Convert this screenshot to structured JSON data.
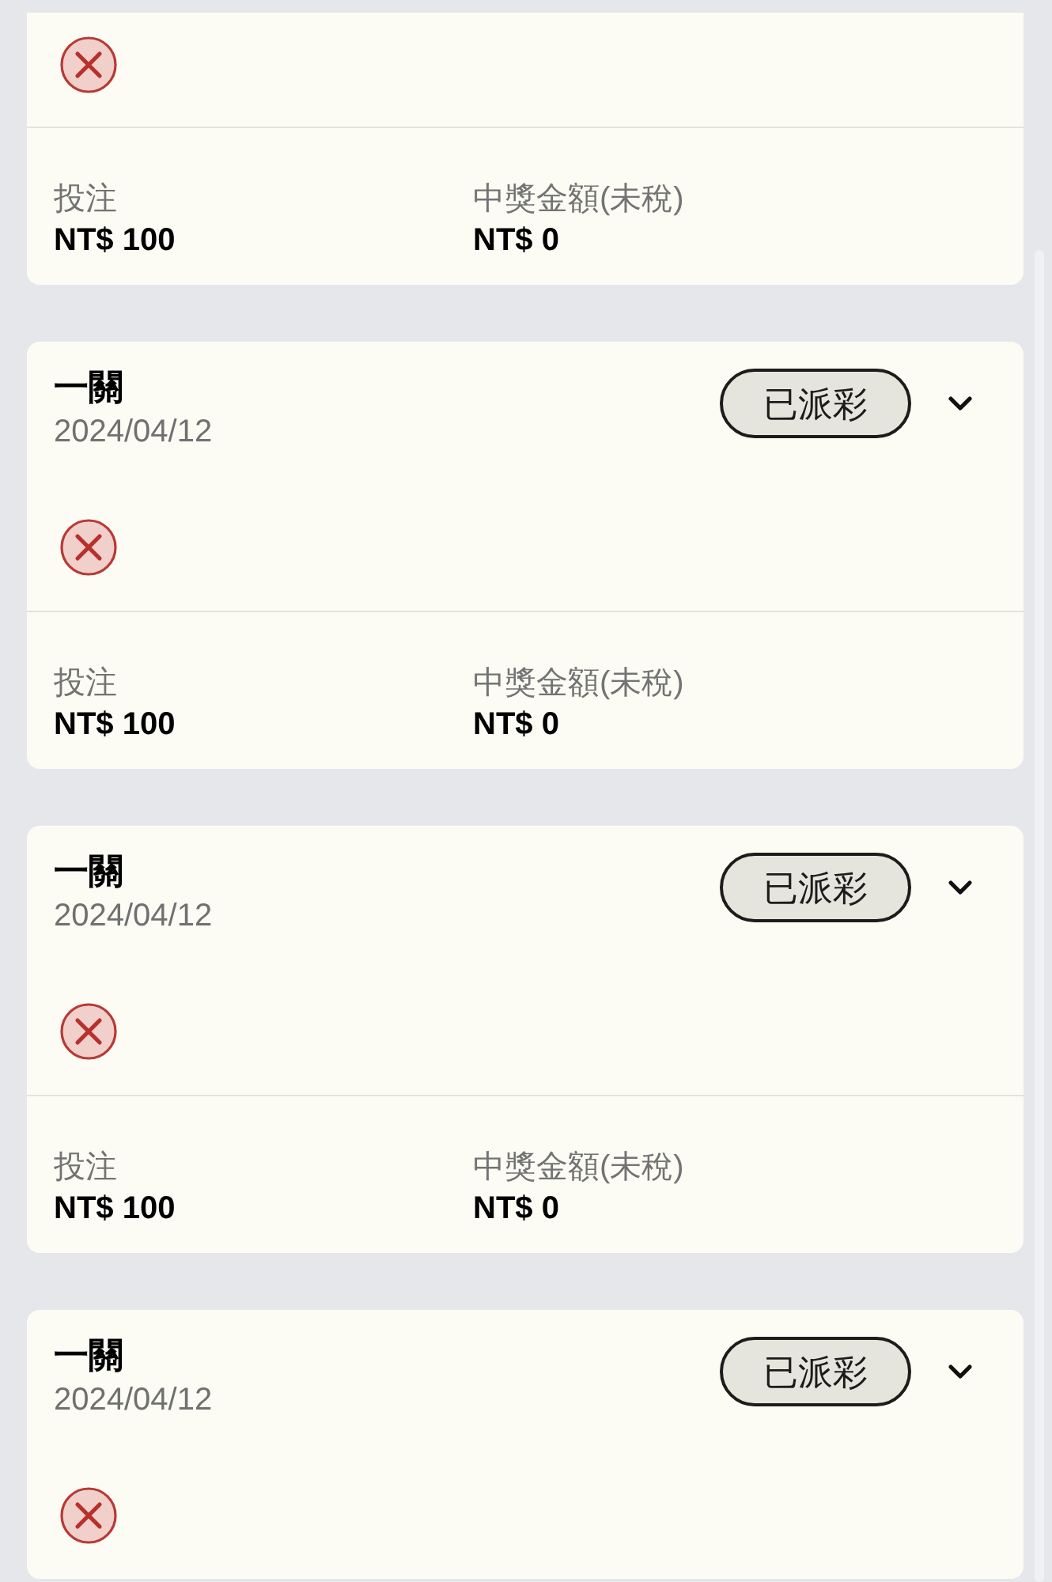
{
  "bets": [
    {
      "won": false,
      "stake_label": "投注",
      "stake": "NT$ 100",
      "payout_label": "中獎金額(未稅)",
      "payout": "NT$ 0"
    },
    {
      "title": "一關",
      "date": "2024/04/12",
      "status": "已派彩",
      "expanded": false,
      "won": false,
      "stake_label": "投注",
      "stake": "NT$ 100",
      "payout_label": "中獎金額(未稅)",
      "payout": "NT$ 0"
    },
    {
      "title": "一關",
      "date": "2024/04/12",
      "status": "已派彩",
      "expanded": false,
      "won": false,
      "stake_label": "投注",
      "stake": "NT$ 100",
      "payout_label": "中獎金額(未稅)",
      "payout": "NT$ 0"
    },
    {
      "title": "一關",
      "date": "2024/04/12",
      "status": "已派彩",
      "expanded": false,
      "won": false
    }
  ]
}
